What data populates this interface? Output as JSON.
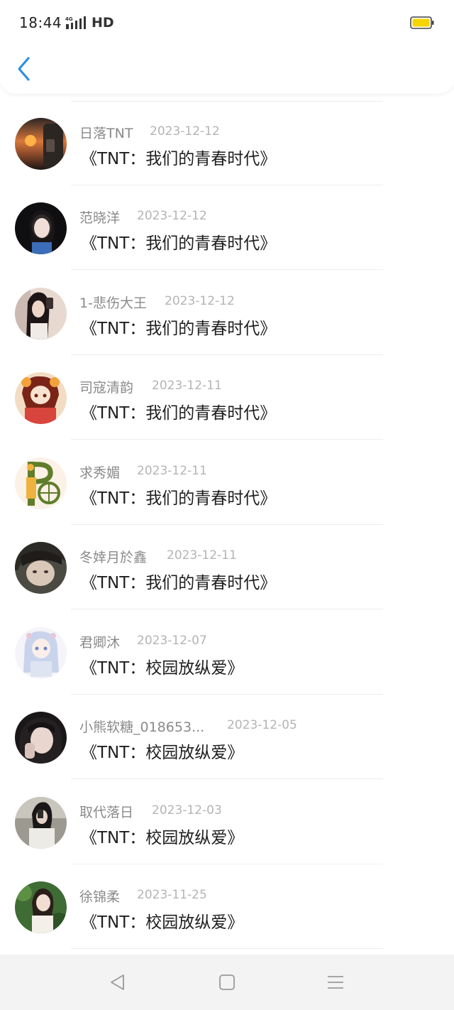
{
  "status_bar": {
    "time": "18:44",
    "network": "4G",
    "hd_label": "HD",
    "battery_color": "#f6d400"
  },
  "nav": {
    "back_icon": "chevron-left-icon",
    "accent_color": "#2f8fe0"
  },
  "list": [
    {
      "name": "日落TNT",
      "date": "2023-12-12",
      "title": "《TNT：我们的青春时代》"
    },
    {
      "name": "范晓洋",
      "date": "2023-12-12",
      "title": "《TNT：我们的青春时代》"
    },
    {
      "name": "1-悲伤大王",
      "date": "2023-12-12",
      "title": "《TNT：我们的青春时代》"
    },
    {
      "name": "司寇清韵",
      "date": "2023-12-11",
      "title": "《TNT：我们的青春时代》"
    },
    {
      "name": "求秀媚",
      "date": "2023-12-11",
      "title": "《TNT：我们的青春时代》"
    },
    {
      "name": "冬婞月於鑫",
      "date": "2023-12-11",
      "title": "《TNT：我们的青春时代》"
    },
    {
      "name": "君卿沐",
      "date": "2023-12-07",
      "title": "《TNT：校园放纵爱》"
    },
    {
      "name": "小熊软糖_018653...",
      "date": "2023-12-05",
      "title": "《TNT：校园放纵爱》"
    },
    {
      "name": "取代落日",
      "date": "2023-12-03",
      "title": "《TNT：校园放纵爱》"
    },
    {
      "name": "徐锦柔",
      "date": "2023-11-25",
      "title": "《TNT：校园放纵爱》"
    }
  ],
  "system_nav": {
    "back": "triangle-back-icon",
    "home": "square-home-icon",
    "menu": "hamburger-menu-icon"
  }
}
